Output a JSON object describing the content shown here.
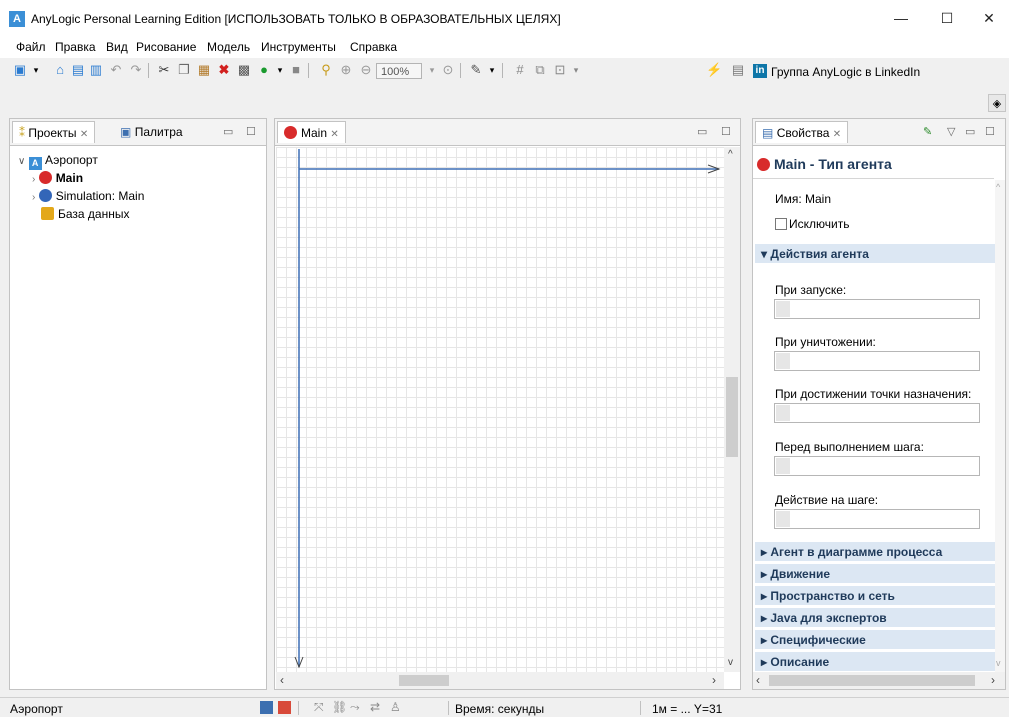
{
  "window": {
    "title": "AnyLogic Personal Learning Edition [ИСПОЛЬЗОВАТЬ ТОЛЬКО В ОБРАЗОВАТЕЛЬНЫХ ЦЕЛЯХ]",
    "logo": "A",
    "minimize": "—",
    "maximize": "☐",
    "close": "✕"
  },
  "menu": [
    "Файл",
    "Правка",
    "Вид",
    "Рисование",
    "Модель",
    "Инструменты",
    "Справка"
  ],
  "toolbar": {
    "zoom": "100%",
    "linkedin_icon": "in",
    "linkedin_label": "Группа AnyLogic в LinkedIn"
  },
  "projects_panel": {
    "tab_projects": "Проекты",
    "tab_palette": "Палитра",
    "tree": {
      "root": "Аэропорт",
      "items": [
        "Main",
        "Simulation: Main",
        "База данных"
      ]
    }
  },
  "editor": {
    "tab": "Main"
  },
  "properties": {
    "tab": "Свойства",
    "header": "Main - Тип агента",
    "name_label": "Имя:",
    "name_value": "Main",
    "exclude_label": "Исключить",
    "section_actions": "Действия агента",
    "fields": [
      "При запуске:",
      "При уничтожении:",
      "При достижении точки назначения:",
      "Перед выполнением шага:",
      "Действие на шаге:"
    ],
    "collapsed_sections": [
      "Агент в диаграмме процесса",
      "Движение",
      "Пространство и сеть",
      "Java для экспертов",
      "Специфические",
      "Описание"
    ]
  },
  "status": {
    "project": "Аэропорт",
    "time_units": "Время: секунды",
    "scale": "1м = ... Y=31"
  }
}
